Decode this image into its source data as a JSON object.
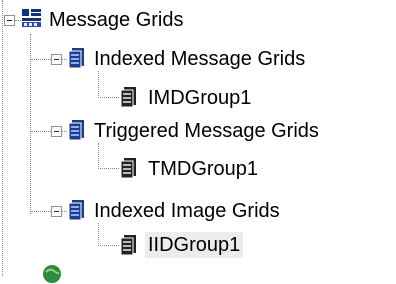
{
  "tree": {
    "root": {
      "label": "Message Grids",
      "icon": "message-grids-icon",
      "expanded": true,
      "children": [
        {
          "label": "Indexed Message Grids",
          "icon": "grid-icon",
          "expanded": true,
          "children": [
            {
              "label": "IMDGroup1",
              "icon": "group-icon"
            }
          ]
        },
        {
          "label": "Triggered Message Grids",
          "icon": "grid-icon",
          "expanded": true,
          "children": [
            {
              "label": "TMDGroup1",
              "icon": "group-icon"
            }
          ]
        },
        {
          "label": "Indexed Image Grids",
          "icon": "grid-icon",
          "expanded": true,
          "children": [
            {
              "label": "IIDGroup1",
              "icon": "group-icon",
              "selected": true
            }
          ]
        }
      ]
    },
    "next_node_icon": "globe-icon"
  },
  "colors": {
    "grid_icon_blue": "#1f3d8f",
    "root_icon_dark": "#14307a",
    "selection_bg": "#ececec",
    "globe_green": "#2e8b3a"
  }
}
